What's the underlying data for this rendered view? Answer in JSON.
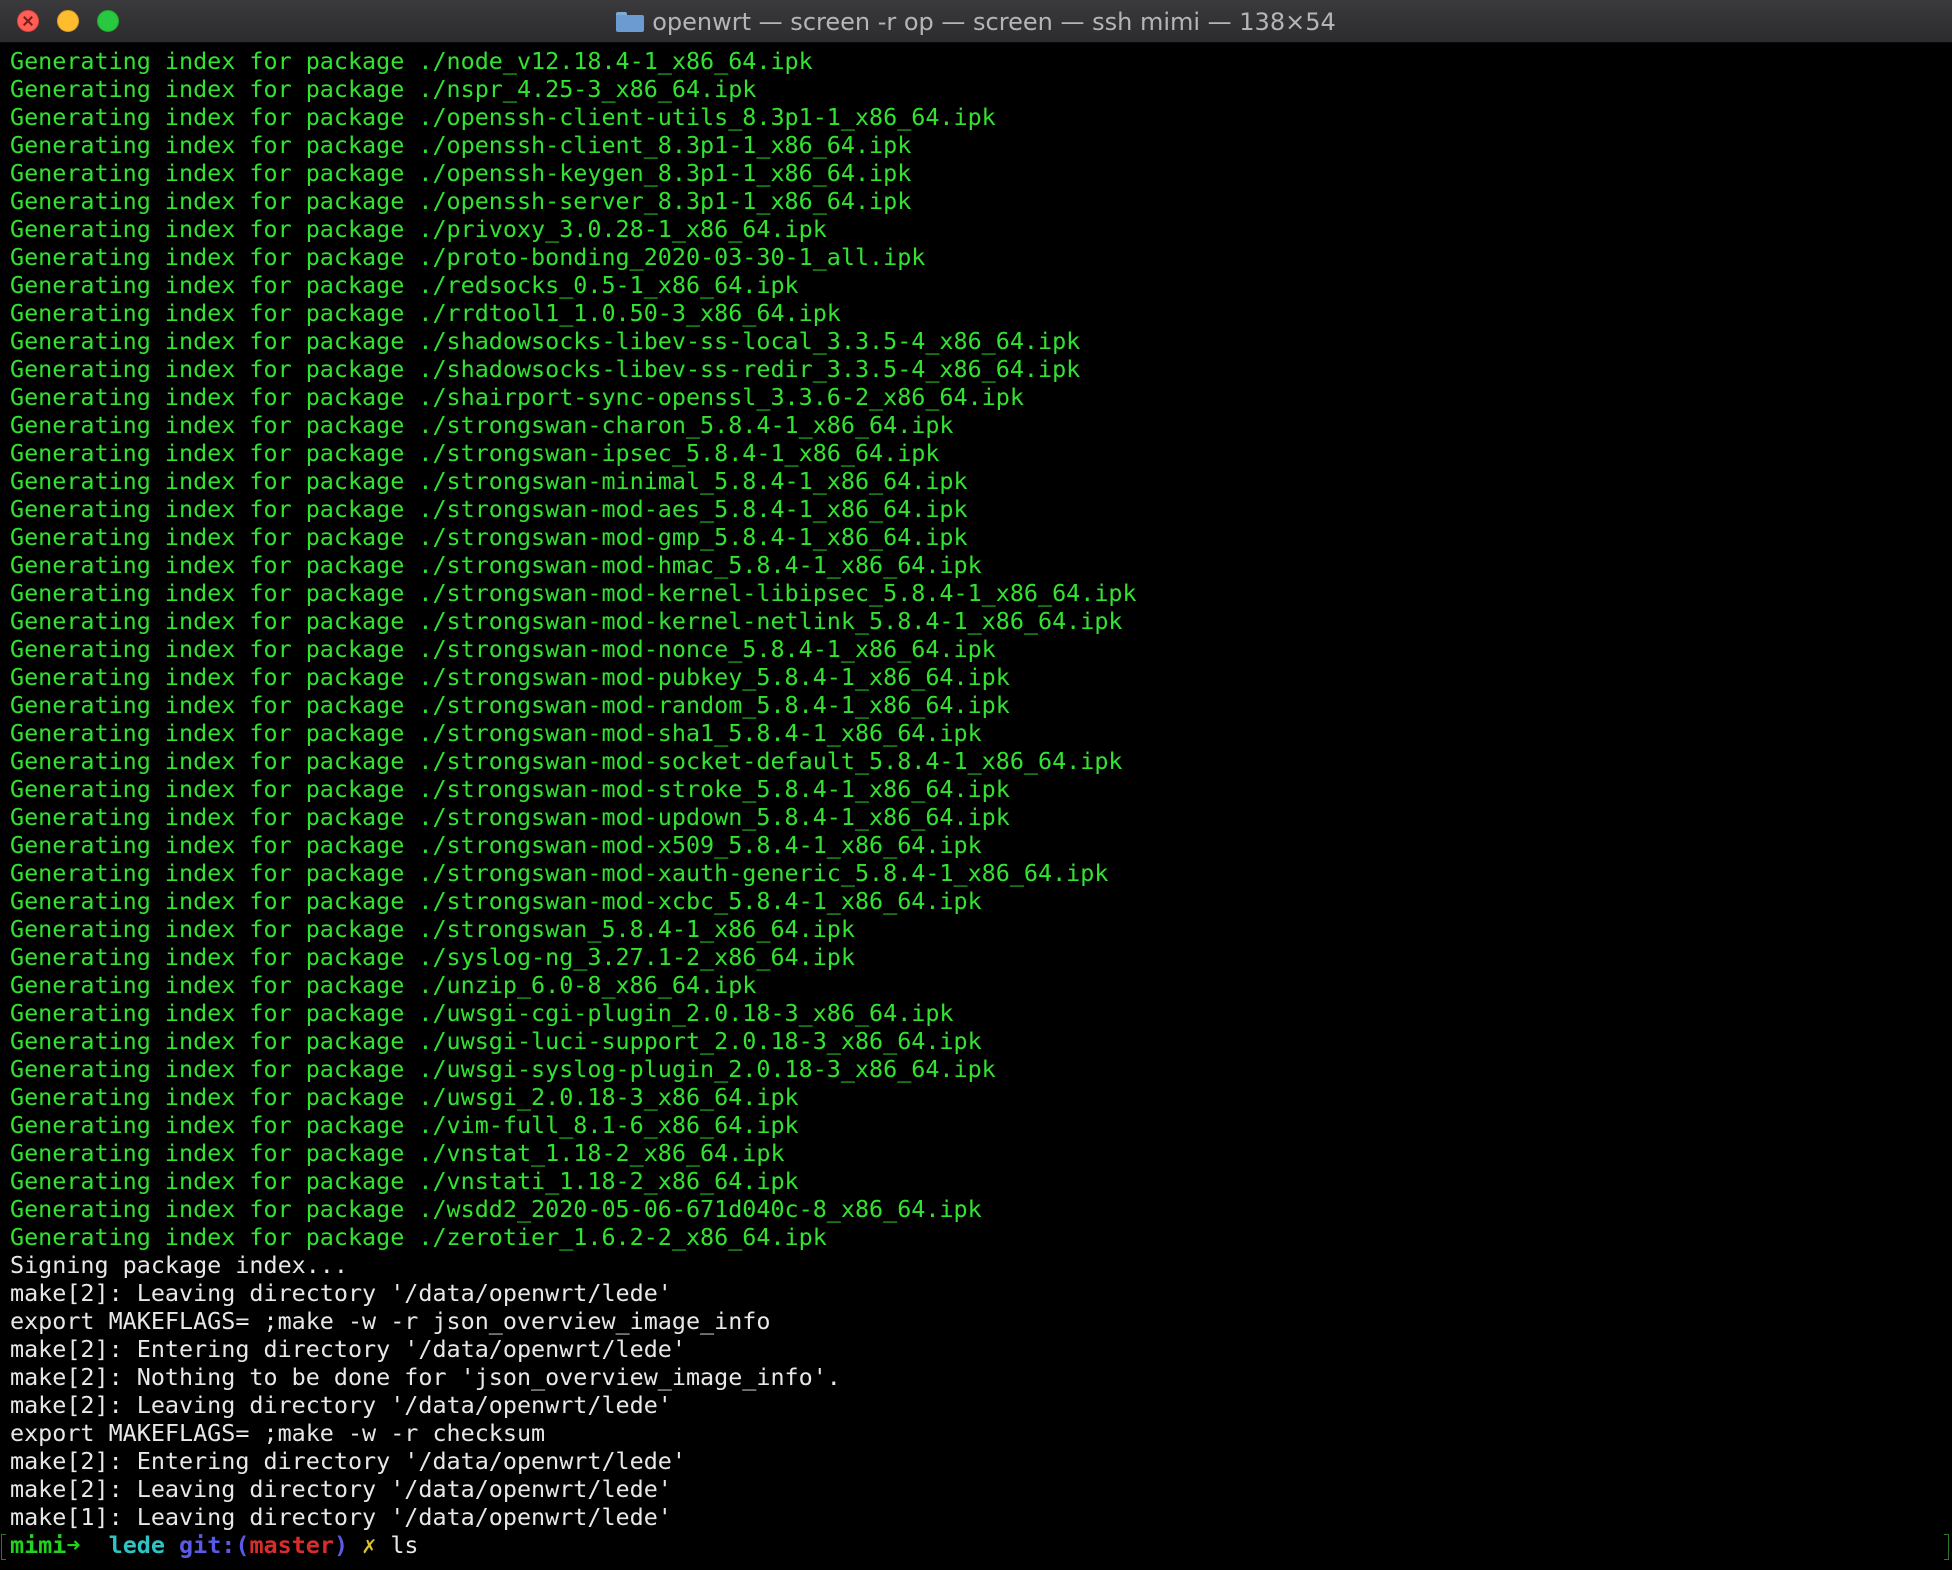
{
  "window": {
    "title": "openwrt — screen -r op — screen — ssh mimi — 138×54"
  },
  "terminal": {
    "lines": [
      "Generating index for package ./node_v12.18.4-1_x86_64.ipk",
      "Generating index for package ./nspr_4.25-3_x86_64.ipk",
      "Generating index for package ./openssh-client-utils_8.3p1-1_x86_64.ipk",
      "Generating index for package ./openssh-client_8.3p1-1_x86_64.ipk",
      "Generating index for package ./openssh-keygen_8.3p1-1_x86_64.ipk",
      "Generating index for package ./openssh-server_8.3p1-1_x86_64.ipk",
      "Generating index for package ./privoxy_3.0.28-1_x86_64.ipk",
      "Generating index for package ./proto-bonding_2020-03-30-1_all.ipk",
      "Generating index for package ./redsocks_0.5-1_x86_64.ipk",
      "Generating index for package ./rrdtool1_1.0.50-3_x86_64.ipk",
      "Generating index for package ./shadowsocks-libev-ss-local_3.3.5-4_x86_64.ipk",
      "Generating index for package ./shadowsocks-libev-ss-redir_3.3.5-4_x86_64.ipk",
      "Generating index for package ./shairport-sync-openssl_3.3.6-2_x86_64.ipk",
      "Generating index for package ./strongswan-charon_5.8.4-1_x86_64.ipk",
      "Generating index for package ./strongswan-ipsec_5.8.4-1_x86_64.ipk",
      "Generating index for package ./strongswan-minimal_5.8.4-1_x86_64.ipk",
      "Generating index for package ./strongswan-mod-aes_5.8.4-1_x86_64.ipk",
      "Generating index for package ./strongswan-mod-gmp_5.8.4-1_x86_64.ipk",
      "Generating index for package ./strongswan-mod-hmac_5.8.4-1_x86_64.ipk",
      "Generating index for package ./strongswan-mod-kernel-libipsec_5.8.4-1_x86_64.ipk",
      "Generating index for package ./strongswan-mod-kernel-netlink_5.8.4-1_x86_64.ipk",
      "Generating index for package ./strongswan-mod-nonce_5.8.4-1_x86_64.ipk",
      "Generating index for package ./strongswan-mod-pubkey_5.8.4-1_x86_64.ipk",
      "Generating index for package ./strongswan-mod-random_5.8.4-1_x86_64.ipk",
      "Generating index for package ./strongswan-mod-sha1_5.8.4-1_x86_64.ipk",
      "Generating index for package ./strongswan-mod-socket-default_5.8.4-1_x86_64.ipk",
      "Generating index for package ./strongswan-mod-stroke_5.8.4-1_x86_64.ipk",
      "Generating index for package ./strongswan-mod-updown_5.8.4-1_x86_64.ipk",
      "Generating index for package ./strongswan-mod-x509_5.8.4-1_x86_64.ipk",
      "Generating index for package ./strongswan-mod-xauth-generic_5.8.4-1_x86_64.ipk",
      "Generating index for package ./strongswan-mod-xcbc_5.8.4-1_x86_64.ipk",
      "Generating index for package ./strongswan_5.8.4-1_x86_64.ipk",
      "Generating index for package ./syslog-ng_3.27.1-2_x86_64.ipk",
      "Generating index for package ./unzip_6.0-8_x86_64.ipk",
      "Generating index for package ./uwsgi-cgi-plugin_2.0.18-3_x86_64.ipk",
      "Generating index for package ./uwsgi-luci-support_2.0.18-3_x86_64.ipk",
      "Generating index for package ./uwsgi-syslog-plugin_2.0.18-3_x86_64.ipk",
      "Generating index for package ./uwsgi_2.0.18-3_x86_64.ipk",
      "Generating index for package ./vim-full_8.1-6_x86_64.ipk",
      "Generating index for package ./vnstat_1.18-2_x86_64.ipk",
      "Generating index for package ./vnstati_1.18-2_x86_64.ipk",
      "Generating index for package ./wsdd2_2020-05-06-671d040c-8_x86_64.ipk",
      "Generating index for package ./zerotier_1.6.2-2_x86_64.ipk",
      "Signing package index...",
      "make[2]: Leaving directory '/data/openwrt/lede'",
      "export MAKEFLAGS= ;make -w -r json_overview_image_info",
      "make[2]: Entering directory '/data/openwrt/lede'",
      "make[2]: Nothing to be done for 'json_overview_image_info'.",
      "make[2]: Leaving directory '/data/openwrt/lede'",
      "export MAKEFLAGS= ;make -w -r checksum",
      "make[2]: Entering directory '/data/openwrt/lede'",
      "make[2]: Leaving directory '/data/openwrt/lede'",
      "make[1]: Leaving directory '/data/openwrt/lede'"
    ],
    "prompt": {
      "host": "mimi",
      "arrow": "➜",
      "dir": "lede",
      "git_label": "git:(",
      "branch": "master",
      "git_close": ")",
      "dirty_mark": "✗",
      "command": "ls"
    }
  },
  "colors": {
    "background": "#000000",
    "output_green": "#32e332",
    "output_white": "#e8e8e8",
    "prompt_host": "#1fd31f",
    "prompt_dir": "#2fc4c4",
    "prompt_git": "#5a5ae6",
    "prompt_branch": "#d92d2d",
    "prompt_dirty": "#d9c32d"
  }
}
